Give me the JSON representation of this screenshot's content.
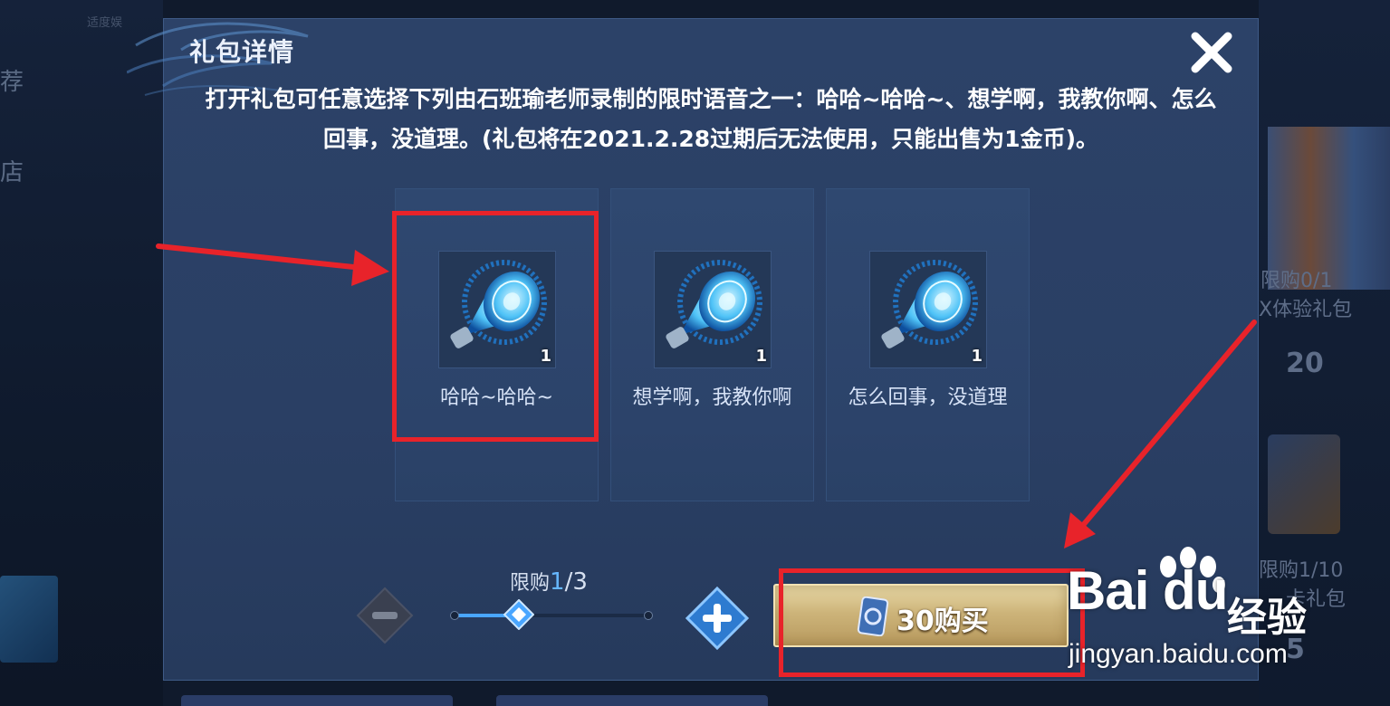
{
  "background": {
    "left_items": [
      "荐",
      "店"
    ],
    "left_small_text": "适度娱",
    "right_texts": [
      "限购0/1",
      "X体验礼包",
      "20",
      "限购1/10",
      "卡礼包",
      "5"
    ]
  },
  "dialog": {
    "title": "礼包详情",
    "description": "打开礼包可任意选择下列由石班瑜老师录制的限时语音之一：哈哈~哈哈~、想学啊，我教你啊、怎么回事，没道理。(礼包将在2021.2.28过期后无法使用，只能出售为1金币)。",
    "close_icon": "close-x-icon",
    "items": [
      {
        "label": "哈哈~哈哈~",
        "count": "1",
        "icon": "speaker-horn-icon"
      },
      {
        "label": "想学啊，我教你啊",
        "count": "1",
        "icon": "speaker-horn-icon"
      },
      {
        "label": "怎么回事，没道理",
        "count": "1",
        "icon": "speaker-horn-icon"
      }
    ],
    "limit": {
      "label": "限购",
      "current": "1",
      "max": "/3",
      "fraction": 0.333
    },
    "buy": {
      "label": "30购买",
      "price_icon": "voucher-ticket-icon"
    }
  },
  "annotations": {
    "highlight_color": "#e8232a"
  },
  "watermark": {
    "logo": "Bai du",
    "brand": "经验",
    "url": "jingyan.baidu.com"
  }
}
